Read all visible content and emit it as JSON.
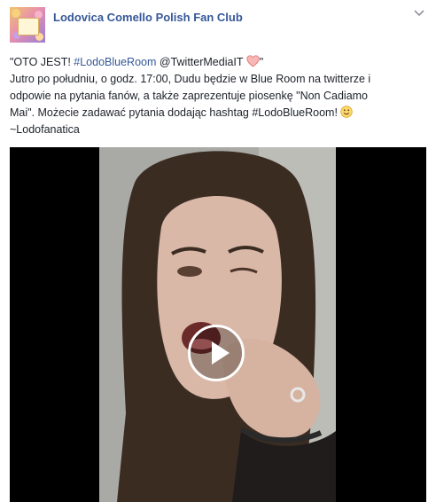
{
  "page": {
    "name": "Lodovica Comello Polish Fan Club"
  },
  "post": {
    "line1_prefix": "\"OTO JEST! ",
    "line1_hashtag": "#LodoBlueRoom",
    "line1_mention": " @TwitterMediaIT ",
    "line1_suffix": "\"",
    "line2": "Jutro po południu, o godz. 17:00, Dudu będzie w Blue Room na twitterze i",
    "line3": "odpowie na pytania fanów, a także zaprezentuje piosenkę \"Non Cadiamo",
    "line4": "Mai\". Możecie zadawać pytania dodając hashtag #LodoBlueRoom! ",
    "line5": "~Lodofanatica"
  },
  "icons": {
    "heart": "heart-emoji-icon",
    "smile": "smile-emoji-icon",
    "chevron": "chevron-down-icon",
    "play": "play-icon"
  },
  "colors": {
    "link": "#365899",
    "text": "#1d2129",
    "heart": "#f4a6a6"
  }
}
